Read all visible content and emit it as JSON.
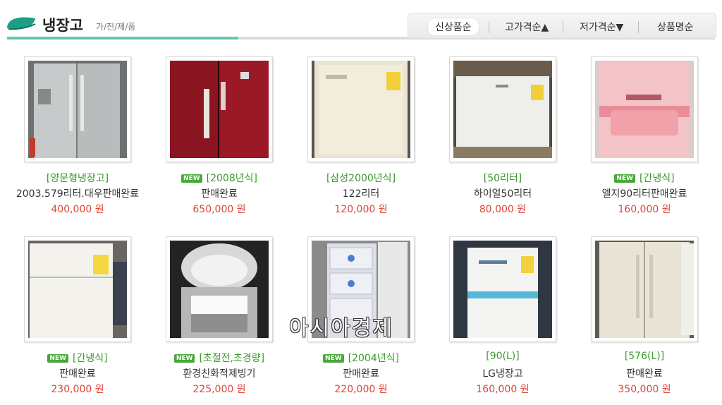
{
  "header": {
    "title": "냉장고",
    "breadcrumb": "가/전/제/품",
    "accent_color": "#5fc7b2"
  },
  "sort": [
    {
      "label": "신상품순",
      "active": true
    },
    {
      "label": "고가격순▲",
      "active": false
    },
    {
      "label": "저가격순▼",
      "active": false
    },
    {
      "label": "상품명순",
      "active": false
    }
  ],
  "new_badge": "NEW",
  "products": [
    {
      "tag": "[양문형냉장고]",
      "is_new": false,
      "desc": "2003.579리터.대우판매완료",
      "price": "400,000 원",
      "image": "silver-side-by-side-fridge"
    },
    {
      "tag": "[2008년식]",
      "is_new": true,
      "desc": "판매완료",
      "price": "650,000 원",
      "image": "red-side-by-side-fridge"
    },
    {
      "tag": "[삼성2000년식]",
      "is_new": false,
      "desc": "122리터",
      "price": "120,000 원",
      "image": "cream-small-fridge"
    },
    {
      "tag": "[50리터]",
      "is_new": false,
      "desc": "하이얼50리터",
      "price": "80,000 원",
      "image": "white-mini-fridge"
    },
    {
      "tag": "[간냉식]",
      "is_new": true,
      "desc": "엘지90리터판매완료",
      "price": "160,000 원",
      "image": "pink-fridge"
    },
    {
      "tag": "[간냉식]",
      "is_new": true,
      "desc": "판매완료",
      "price": "230,000 원",
      "image": "white-two-door-fridge"
    },
    {
      "tag": "[초절전,초경량]",
      "is_new": true,
      "desc": "환경친화적제빙기",
      "price": "225,000 원",
      "image": "ice-maker"
    },
    {
      "tag": "[2004년식]",
      "is_new": true,
      "desc": "판매완료",
      "price": "220,000 원",
      "image": "drawer-freezer"
    },
    {
      "tag": "[90(L)]",
      "is_new": false,
      "desc": "LG냉장고",
      "price": "160,000 원",
      "image": "white-blue-fridge"
    },
    {
      "tag": "[576(L)]",
      "is_new": false,
      "desc": "판매완료",
      "price": "350,000 원",
      "image": "white-side-by-side-fridge"
    }
  ],
  "watermark": "아시아경제"
}
